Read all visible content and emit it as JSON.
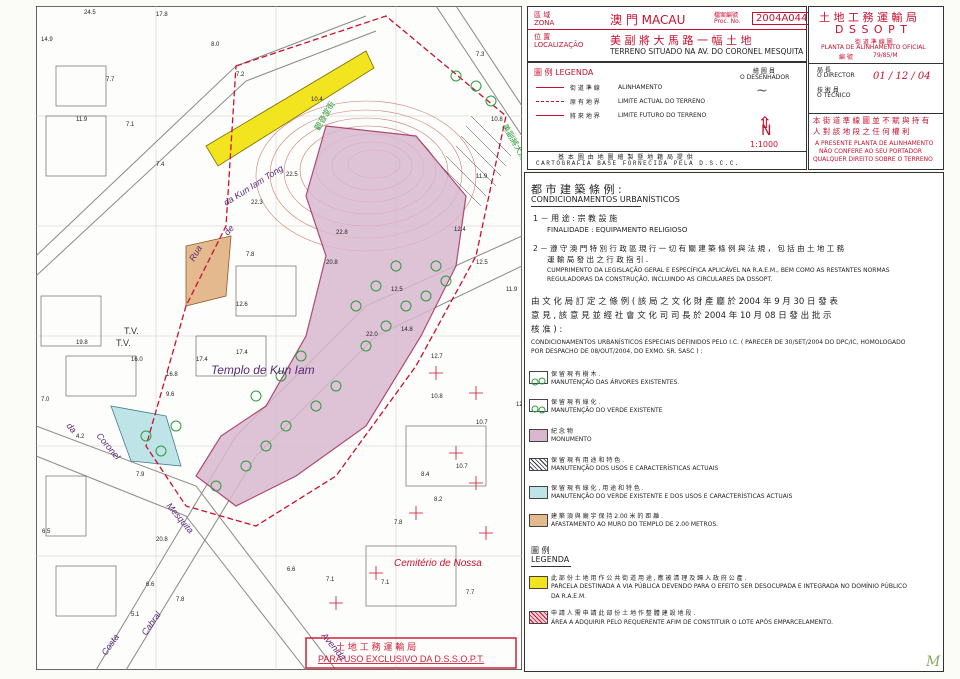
{
  "header": {
    "zona_label_cn": "區 域",
    "zona_label_pt": "ZONA",
    "zona_value": "澳 門 MACAU",
    "proc_label_cn": "檔案編號",
    "proc_label_pt": "Proc. No.",
    "proc_value": "2004A044",
    "loc_label_cn": "位 置",
    "loc_label_pt": "LOCALIZAÇÃO",
    "loc_value_cn": "美 副 將 大 馬 路 一 幅 土 地",
    "loc_value_pt": "TERRENO SITUADO NA AV. DO CORONEL MESQUITA"
  },
  "legend_top": {
    "title": "圖 例 LEGENDA",
    "items": [
      {
        "cn": "街 道 準 線",
        "pt": "ALINHAMENTO"
      },
      {
        "cn": "原 有 地 界",
        "pt": "LIMITE ACTUAL DO TERRENO"
      },
      {
        "cn": "將 來 地 界",
        "pt": "LIMITE FUTURO DO TERRENO"
      }
    ],
    "desenhador_cn": "繪 圖 員",
    "desenhador_pt": "O DESENHADOR",
    "north": "N",
    "scale": "1:1000",
    "cartografia_cn": "基 本 圖 由 地 圖 繪 製 暨 地 籍 局 提 供",
    "cartografia_pt": "CARTOGRAFIA BASE FORNECIDA PELA D.S.C.C."
  },
  "dssopt": {
    "title_cn": "土 地 工 務 運 輸 局",
    "title_pt": "D S S O P T",
    "subtitle_cn": "街 道 準 線 圖",
    "subtitle_pt": "PLANTA DE ALINHAMENTO OFICIAL",
    "number_label": "編 號",
    "number_value": "79/85/M",
    "director_cn": "局 長",
    "director_pt": "O DIRECTOR",
    "date_hand": "01 / 12 / 04",
    "tecnico_cn": "技 術 員",
    "tecnico_pt": "O TÉCNICO",
    "warning_cn_1": "本 街 道 準 線 圖 並 不 賦 與 持 有",
    "warning_cn_2": "人 對 該 地 段 之 任 何 權 利",
    "warning_pt_1": "A PRESENTE PLANTA DE ALINHAMENTO",
    "warning_pt_2": "NÃO CONFERE AO SEU PORTADOR",
    "warning_pt_3": "QUALQUER DIREITO SOBRE O TERRENO"
  },
  "conditions": {
    "title_cn": "都 市 建 築 條 例 :",
    "title_pt": "CONDICIONAMENTOS URBANÍSTICOS",
    "c1_cn": "1 － 用 途 : 宗 教 設 施",
    "c1_pt": "FINALIDADE : EQUIPAMENTO RELIGIOSO",
    "c2_cn_1": "2 － 遵 守 澳 門 特 別 行 政 區 現 行 一 切 有 關 建 築 條 例 與 法 規 ， 包 括 由 土 地 工 務",
    "c2_cn_2": "運 輸 局 發 出 之 行 政 指 引 .",
    "c2_pt_1": "CUMPRIMENTO DA LEGISLAÇÃO GERAL E ESPECÍFICA APLICÁVEL NA R.A.E.M., BEM COMO AS RESTANTES NORMAS",
    "c2_pt_2": "REGULADORAS DA CONSTRUÇÃO, INCLUINDO AS CIRCULARES DA DSSOPT.",
    "ic_cn_1": "由 文 化 局 訂 定 之 條 例 ( 該 局 之 文 化 財 產 廳 於 2004 年 9 月 30 日 發 表",
    "ic_cn_2": "意 見 , 該 意 見 並 經 社 會 文 化 司 司 長 於 2004 年 10 月 08 日 發 出 批 示",
    "ic_cn_3": "核 准 ) :",
    "ic_pt_1": "CONDICIONAMENTOS URBANÍSTICOS ESPECIAIS DEFINIDOS PELO I.C. ( PARECER DE 30/SET/2004 DO DPC/IC, HOMOLOGADO",
    "ic_pt_2": "POR DESPACHO DE 08/OUT/2004, DO EXMO. SR. SASC ) :",
    "items": [
      {
        "cn": "保 留 現 有 樹 木 .",
        "pt": "MANUTENÇÃO DAS ÁRVORES EXISTENTES."
      },
      {
        "cn": "保 留 現 有 綠 化 .",
        "pt": "MANUTENÇÃO DO VERDE EXISTENTE"
      },
      {
        "cn": "紀 念 物",
        "pt": "MONUMENTO"
      },
      {
        "cn": "保 留 現 有 用 途 和 特 色 .",
        "pt": "MANUTENÇÃO DOS USOS E CARACTERÍSTICAS ACTUAIS"
      },
      {
        "cn": "保 留 現 有 綠 化 , 用 途 和 特 色 .",
        "pt": "MANUTENÇÃO DO VERDE EXISTENTE E DOS USOS E CARACTERÍSTICAS ACTUAIS"
      },
      {
        "cn": "建 築 須 與 廟 宇 保 持 2.00 米 的 距 離 .",
        "pt": "AFASTAMENTO AO MURO DO TEMPLO DE 2.00 METROS."
      }
    ],
    "legend_cn": "圖 例",
    "legend_pt": "LEGENDA",
    "leg1_cn": "此 部 份 土 地 用 作 公 共 街 道 用 途 , 應 被 清 理 及 歸 入 政 府 公 產 .",
    "leg1_pt_1": "PARCELA DESTINADA A VIA PÚBLICA DEVENDO PARA O EFEITO SER DESOCUPADA E INTEGRADA NO DOMÍNIO PÚBLICO",
    "leg1_pt_2": "DA R.A.E.M.",
    "leg2_cn": "申 請 人 需 申 請 此 部 份 土 地 作 整 體 建 設 地 段 .",
    "leg2_pt": "ÁREA A ADQUIRIR PELO REQUERENTE AFIM DE CONSTITUIR O LOTE APÓS EMPARCELAMENTO."
  },
  "map": {
    "stamp_cn": "土 地 工 務 運 輸 局",
    "stamp_pt": "PARA USO EXCLUSIVO DA D.S.S.O.P.T.",
    "street_da_cunha": "da Kun Iam Tong",
    "street_rua": "Rua",
    "street_coronel": "Coronel",
    "street_mesquita": "Mesquita",
    "street_costa": "Costa",
    "street_cabral": "Cabral",
    "street_avenida": "Avenida",
    "street_da": "da",
    "street_de": "de",
    "templo": "Templo de Kun Iam",
    "cemiterio": "Cemitério de Nossa",
    "tv1": "T.V.",
    "tv2": "T.V.",
    "street_cn_1": "觀音堂街",
    "street_cn_2": "美副將大馬路",
    "heights": [
      "24.5",
      "17.8",
      "14.9",
      "8.0",
      "7.2",
      "7.7",
      "11.9",
      "7.1",
      "7.4",
      "10.4",
      "22.3",
      "22.8",
      "20.8",
      "12.4",
      "12.5",
      "22.0",
      "11.9",
      "14.8",
      "12.7",
      "10.8",
      "8.4",
      "10.7",
      "10.7",
      "12.4",
      "8.2",
      "7.8",
      "6.6",
      "7.1",
      "7.1",
      "7.7",
      "6.6",
      "19.8",
      "16.0",
      "16.8",
      "12.6",
      "22.5",
      "6.5",
      "20.8",
      "17.4",
      "9.6",
      "7.3",
      "7.0",
      "4.2",
      "7.9",
      "11.9",
      "17.4",
      "7.8",
      "12.5",
      "10.8",
      "7.8",
      "5.1"
    ]
  },
  "handwriting": {
    "corner_mark": "M"
  },
  "colors": {
    "monument": "#d9b8cf",
    "yellow_strip": "#f2e41f",
    "cyan_strip": "#bfe4e8",
    "orange_strip": "#e5b98e",
    "red_stamp": "#d2203a",
    "tree_green": "#2c9b3f"
  }
}
